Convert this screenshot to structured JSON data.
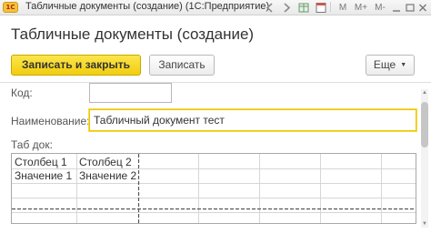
{
  "window": {
    "title": "Табличные документы (создание)  (1С:Предприятие)",
    "logo_text": "1С",
    "controls": {
      "m_label": "M",
      "m_plus_label": "M+",
      "m_minus_label": "M-",
      "calendar_label": "31"
    }
  },
  "form": {
    "title": "Табличные документы (создание)"
  },
  "toolbar": {
    "save_and_close_label": "Записать и закрыть",
    "save_label": "Записать",
    "more_label": "Еще"
  },
  "fields": {
    "code_label": "Код:",
    "code_value": "",
    "name_label": "Наименование:",
    "name_value": "Табличный документ тест",
    "tab_label": "Таб док:"
  },
  "spreadsheet": {
    "rows": [
      [
        "Столбец 1",
        "Столбец 2"
      ],
      [
        "Значение 1",
        "Значение 2"
      ]
    ]
  },
  "colors": {
    "accent_yellow": "#f2cd0e",
    "focus_border": "#f0c500",
    "text": "#333333"
  }
}
